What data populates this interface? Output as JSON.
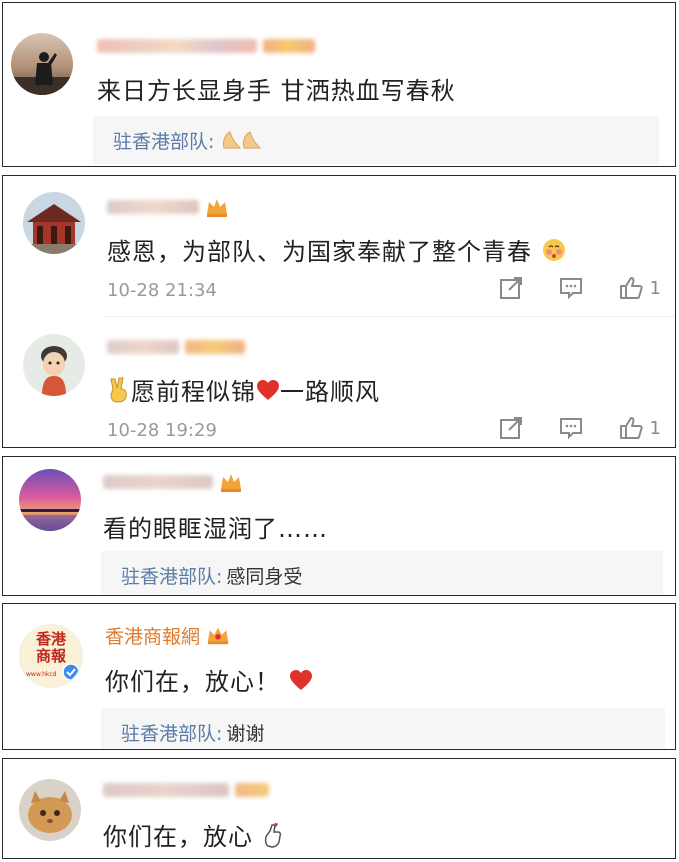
{
  "comments": [
    {
      "text": "来日方长显身手 甘洒热血写春秋",
      "reply_author": "驻香港部队:",
      "reply_text": ""
    },
    {
      "text": "感恩，为部队、为国家奉献了整个青春",
      "time": "10-28 21:34",
      "like_count": "1",
      "sub": {
        "text": "愿前程似锦",
        "text_after": "一路顺风",
        "time": "10-28 19:29",
        "like_count": "1"
      }
    },
    {
      "text": "看的眼眶湿润了……",
      "reply_author": "驻香港部队:",
      "reply_text": "感同身受"
    },
    {
      "user": "香港商報網",
      "text": "你们在，放心！",
      "reply_author": "驻香港部队:",
      "reply_text": "谢谢",
      "logo_text": [
        "香港",
        "商報",
        "www.hkcd"
      ]
    },
    {
      "text": "你们在，放心"
    }
  ],
  "colors": {
    "reply_author": "#5a7ca6",
    "brand_name": "#e07a2c",
    "meta": "#9a9a9a",
    "heart": "#e0322c",
    "crown": "#f2a43a"
  },
  "icons": [
    "share-icon",
    "comment-icon",
    "like-icon",
    "crown-icon",
    "verified-icon",
    "heart-icon"
  ]
}
